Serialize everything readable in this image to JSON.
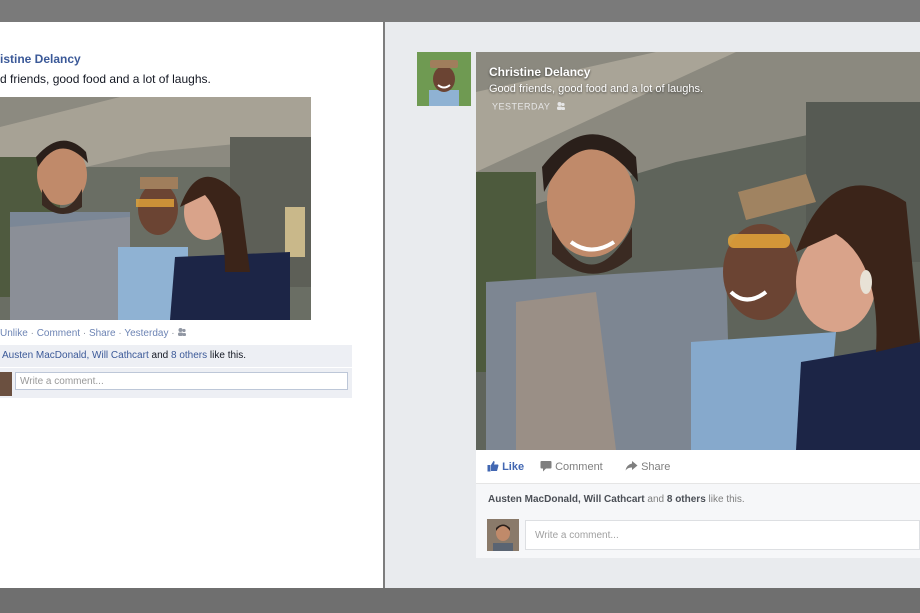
{
  "old_post": {
    "author": "istine Delancy",
    "status_text": "d friends, good food and a lot of laughs.",
    "actions": {
      "unlike": "Unlike",
      "sep": " · ",
      "comment": "Comment",
      "share": "Share",
      "time": "Yesterday",
      "audience_icon": "friends-icon"
    },
    "likes": {
      "names": "Austen MacDonald, Will Cathcart",
      "and": "and",
      "others": "8 others",
      "suffix": "like this."
    },
    "comment_placeholder": "Write a comment..."
  },
  "new_post": {
    "author": "Christine Delancy",
    "status_text": "Good friends, good food and a lot of laughs.",
    "time": "YESTERDAY",
    "audience_icon": "friends-icon",
    "actions": {
      "like": "Like",
      "comment": "Comment",
      "share": "Share"
    },
    "likes": {
      "names": "Austen MacDonald, Will Cathcart",
      "and": "and",
      "others": "8 others",
      "suffix": "like this."
    },
    "comment_placeholder": "Write a comment..."
  },
  "colors": {
    "link_blue": "#3b5998",
    "like_blue": "#4267b2",
    "frame_gray": "#7d7d7d"
  }
}
